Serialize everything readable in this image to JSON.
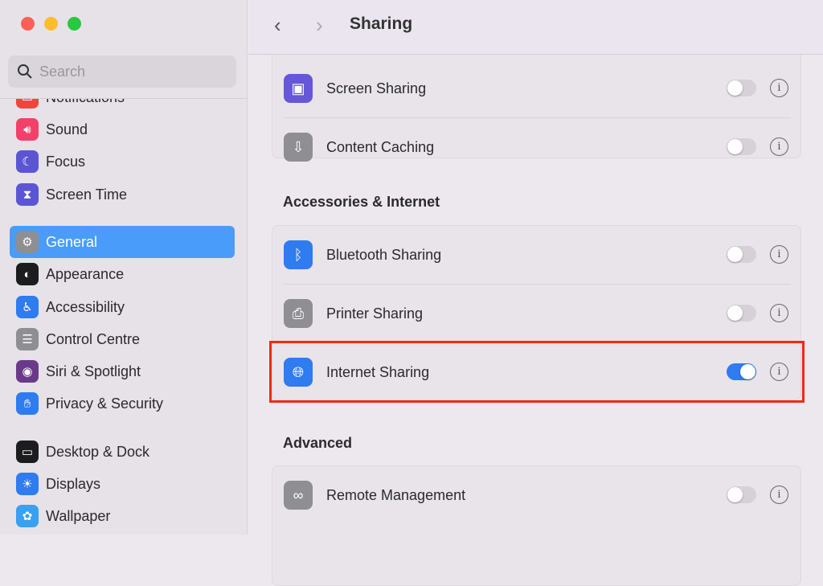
{
  "window": {
    "title": "Sharing"
  },
  "sidebar": {
    "search_placeholder": "Search",
    "items": [
      {
        "label": "Notifications",
        "color": "#f0453a",
        "icon": "bell-icon"
      },
      {
        "label": "Sound",
        "color": "#f2406a",
        "icon": "speaker-icon"
      },
      {
        "label": "Focus",
        "color": "#5b55d6",
        "icon": "moon-icon"
      },
      {
        "label": "Screen Time",
        "color": "#5b55d6",
        "icon": "hourglass-icon"
      },
      {
        "label": "General",
        "color": "#8e8e93",
        "icon": "gear-icon",
        "selected": true
      },
      {
        "label": "Appearance",
        "color": "#1c1c1e",
        "icon": "appearance-icon"
      },
      {
        "label": "Accessibility",
        "color": "#2f7bf0",
        "icon": "accessibility-icon"
      },
      {
        "label": "Control Centre",
        "color": "#8e8e93",
        "icon": "toggles-icon"
      },
      {
        "label": "Siri & Spotlight",
        "color": "#6a3a8a",
        "icon": "siri-icon"
      },
      {
        "label": "Privacy & Security",
        "color": "#2f7bf0",
        "icon": "hand-icon"
      },
      {
        "label": "Desktop & Dock",
        "color": "#1c1c1e",
        "icon": "dock-icon"
      },
      {
        "label": "Displays",
        "color": "#2f7bf0",
        "icon": "sun-icon"
      },
      {
        "label": "Wallpaper",
        "color": "#3aa0f0",
        "icon": "flower-icon"
      }
    ]
  },
  "sections": [
    {
      "title": "",
      "rows": [
        {
          "label": "Screen Sharing",
          "on": false,
          "color": "#6656d8",
          "icon": "screen-sharing-icon"
        },
        {
          "label": "Content Caching",
          "on": false,
          "color": "#8e8e93",
          "icon": "download-icon"
        }
      ]
    },
    {
      "title": "Accessories & Internet",
      "rows": [
        {
          "label": "Bluetooth Sharing",
          "on": false,
          "color": "#2f7bf0",
          "icon": "bluetooth-icon"
        },
        {
          "label": "Printer Sharing",
          "on": false,
          "color": "#8e8e93",
          "icon": "printer-icon"
        },
        {
          "label": "Internet Sharing",
          "on": true,
          "color": "#2f7bf0",
          "icon": "globe-icon",
          "highlighted": true
        }
      ]
    },
    {
      "title": "Advanced",
      "rows": [
        {
          "label": "Remote Management",
          "on": false,
          "color": "#8e8e93",
          "icon": "binoculars-icon"
        }
      ]
    }
  ],
  "glyphs": {
    "info": "i",
    "back": "‹",
    "forward": "›"
  },
  "highlight_color": "#f02a14"
}
